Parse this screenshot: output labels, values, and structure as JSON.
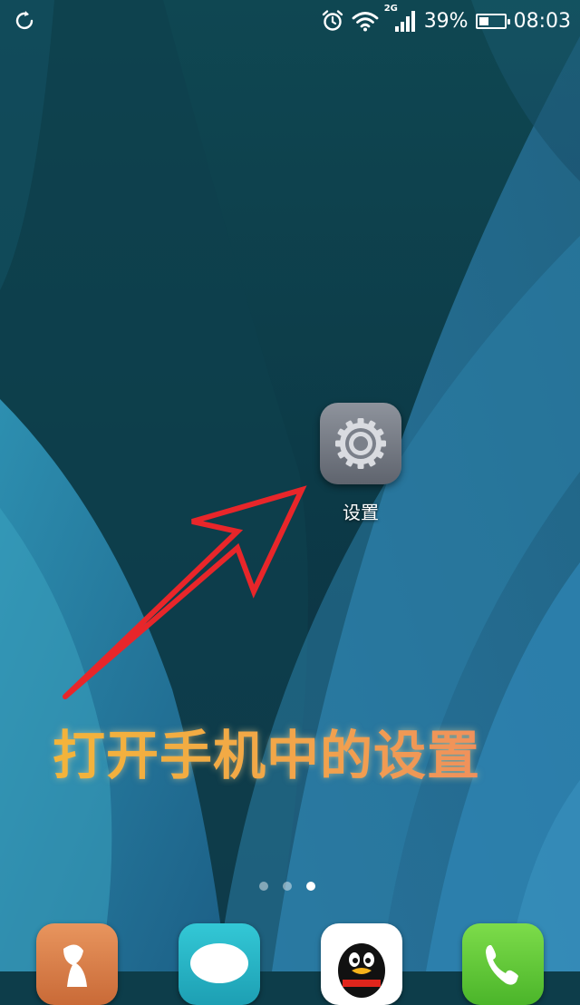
{
  "status_bar": {
    "refresh_icon": "sync-icon",
    "alarm_icon": "alarm-icon",
    "wifi_icon": "wifi-icon",
    "network_type": "2G",
    "signal_icon": "signal-icon",
    "battery_percent": "39%",
    "battery_level": 0.39,
    "time": "08:03"
  },
  "home": {
    "app": {
      "label": "设置",
      "icon": "gear-icon"
    },
    "caption": "打开手机中的设置",
    "arrow_color": "#e8262a",
    "caption_color": "#f2a748",
    "pages": {
      "count": 3,
      "active": 3
    }
  },
  "dock": {
    "apps": [
      {
        "icon": "contacts-icon"
      },
      {
        "icon": "messages-icon"
      },
      {
        "icon": "qq-icon"
      },
      {
        "icon": "phone-icon"
      }
    ]
  }
}
